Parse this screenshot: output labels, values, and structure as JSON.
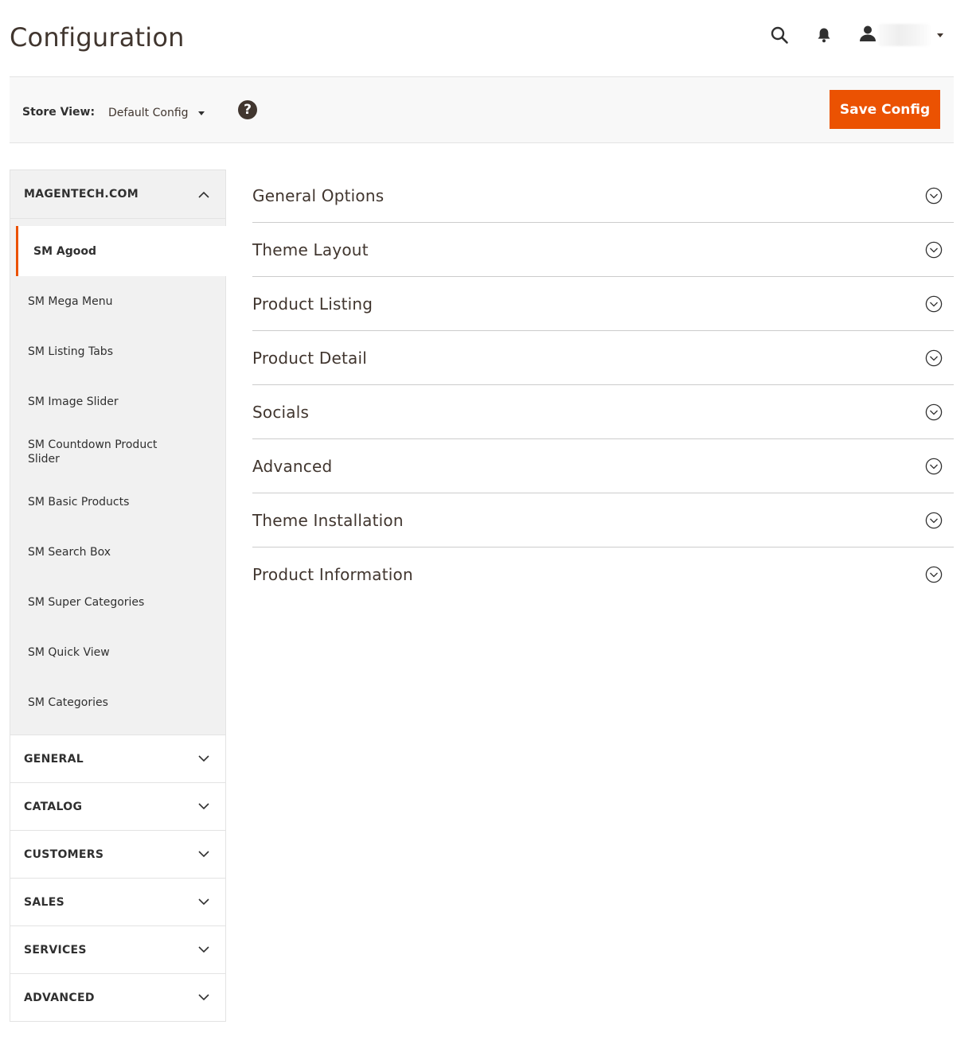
{
  "page": {
    "title": "Configuration"
  },
  "header": {
    "search_icon": "search-icon",
    "notifications_icon": "bell-icon",
    "account_icon": "user-icon",
    "username": ""
  },
  "toolbar": {
    "store_view_label": "Store View:",
    "store_view_value": "Default Config",
    "help_symbol": "?",
    "save_label": "Save Config"
  },
  "colors": {
    "accent": "#eb5202",
    "title": "#41362f",
    "sidebar_bg": "#f1f1f1",
    "toolbar_bg": "#f8f8f8"
  },
  "sidebar": {
    "expanded_tab": {
      "title": "MAGENTECH.COM",
      "items": [
        {
          "label": "SM Agood",
          "active": true
        },
        {
          "label": "SM Mega Menu"
        },
        {
          "label": "SM Listing Tabs"
        },
        {
          "label": "SM Image Slider"
        },
        {
          "label": "SM Countdown Product Slider"
        },
        {
          "label": "SM Basic Products"
        },
        {
          "label": "SM Search Box"
        },
        {
          "label": "SM Super Categories"
        },
        {
          "label": "SM Quick View"
        },
        {
          "label": "SM Categories"
        }
      ]
    },
    "collapsed_tabs": [
      {
        "title": "GENERAL"
      },
      {
        "title": "CATALOG"
      },
      {
        "title": "CUSTOMERS"
      },
      {
        "title": "SALES"
      },
      {
        "title": "SERVICES"
      },
      {
        "title": "ADVANCED"
      }
    ]
  },
  "main": {
    "sections": [
      {
        "title": "General Options"
      },
      {
        "title": "Theme Layout"
      },
      {
        "title": "Product Listing"
      },
      {
        "title": "Product Detail"
      },
      {
        "title": "Socials"
      },
      {
        "title": "Advanced"
      },
      {
        "title": "Theme Installation"
      },
      {
        "title": "Product Information"
      }
    ]
  }
}
